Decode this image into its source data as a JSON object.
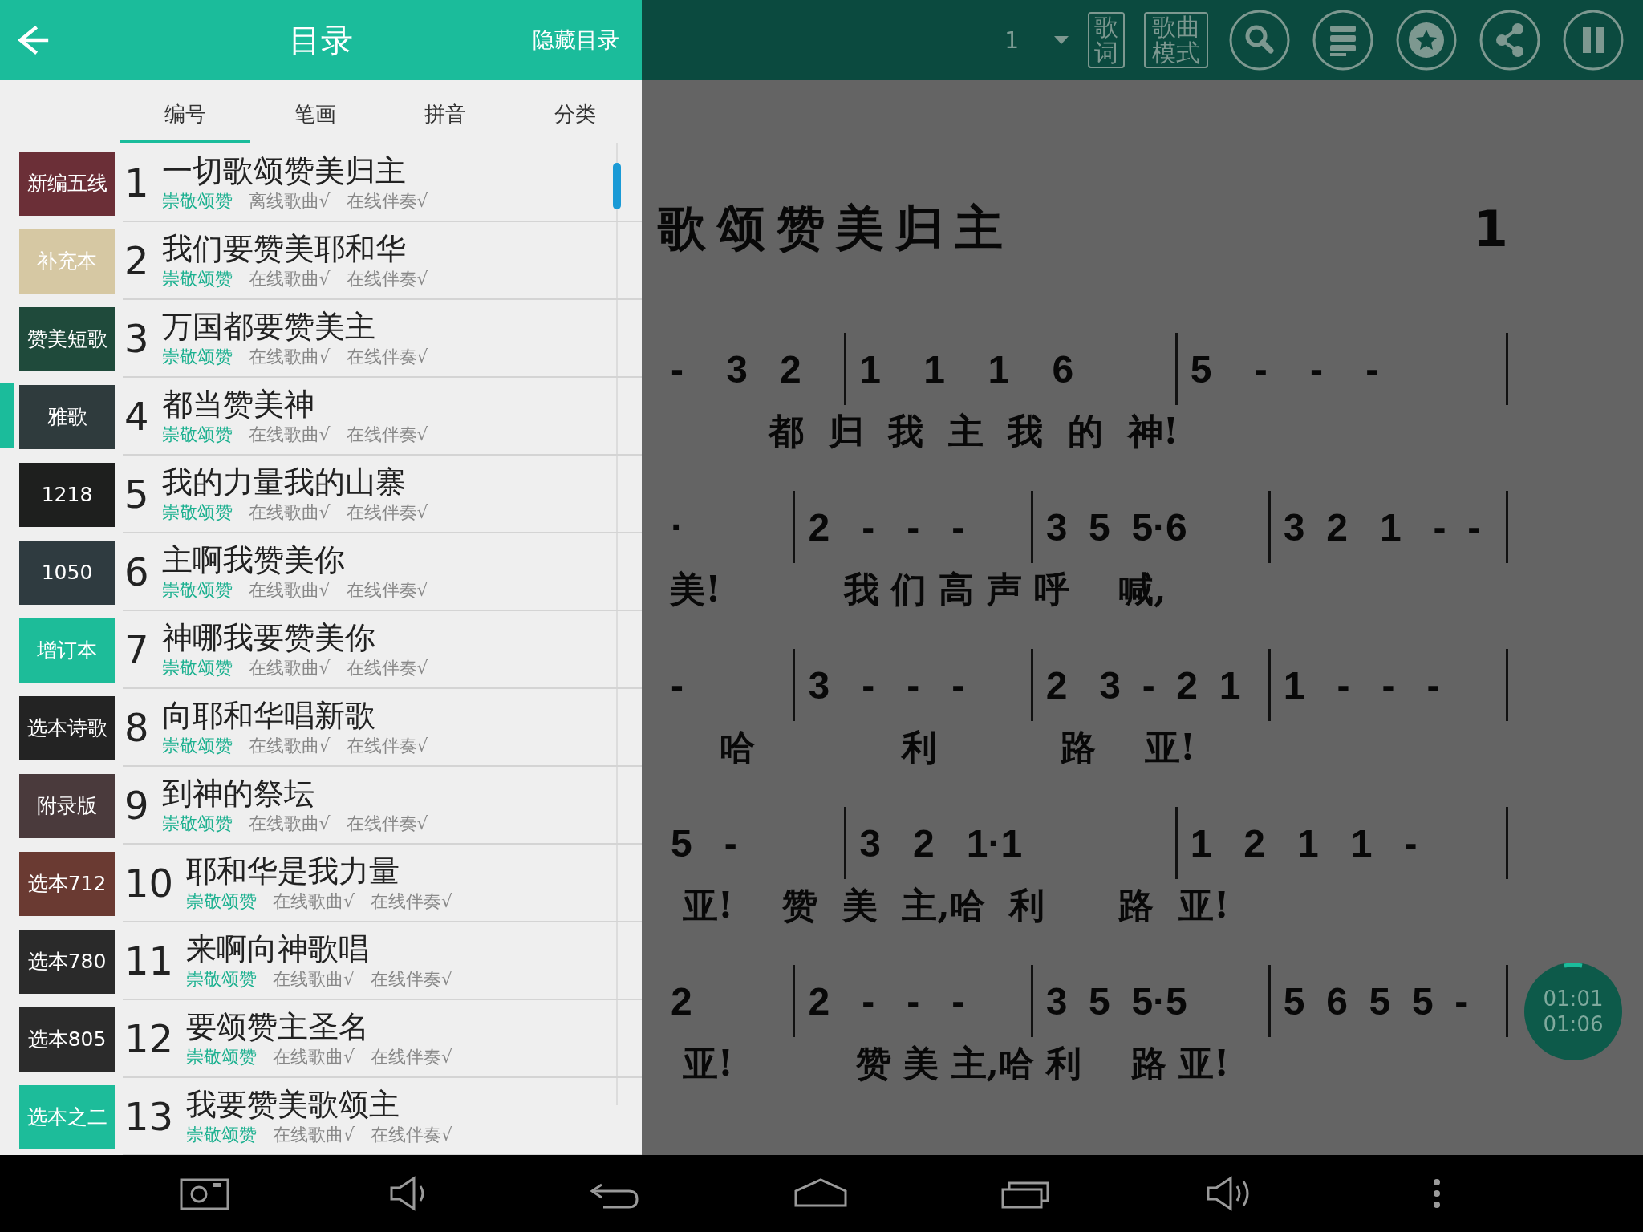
{
  "header": {
    "title": "目录",
    "hide_button": "隐藏目录"
  },
  "toolbar": {
    "page": "1",
    "lyrics_button": "歌词",
    "mode_button": "歌曲模式"
  },
  "sort_tabs": [
    {
      "label": "编号",
      "selected": true
    },
    {
      "label": "笔画",
      "selected": false
    },
    {
      "label": "拼音",
      "selected": false
    },
    {
      "label": "分类",
      "selected": false
    }
  ],
  "songs": [
    {
      "badge": "新编五线",
      "color": "#6b2f37",
      "number": "1",
      "title": "一切歌颂赞美归主",
      "category": "崇敬颂赞",
      "song_status": "离线歌曲√",
      "accompaniment": "在线伴奏√",
      "selected": false
    },
    {
      "badge": "补充本",
      "color": "#d6c8a3",
      "number": "2",
      "title": "我们要赞美耶和华",
      "category": "崇敬颂赞",
      "song_status": "在线歌曲√",
      "accompaniment": "在线伴奏√",
      "selected": false
    },
    {
      "badge": "赞美短歌",
      "color": "#1f4a3b",
      "number": "3",
      "title": "万国都要赞美主",
      "category": "崇敬颂赞",
      "song_status": "在线歌曲√",
      "accompaniment": "在线伴奏√",
      "selected": false
    },
    {
      "badge": "雅歌",
      "color": "#2f3b3d",
      "number": "4",
      "title": "都当赞美神",
      "category": "崇敬颂赞",
      "song_status": "在线歌曲√",
      "accompaniment": "在线伴奏√",
      "selected": true
    },
    {
      "badge": "1218",
      "color": "#1e1f1e",
      "number": "5",
      "title": "我的力量我的山寨",
      "category": "崇敬颂赞",
      "song_status": "在线歌曲√",
      "accompaniment": "在线伴奏√",
      "selected": false
    },
    {
      "badge": "1050",
      "color": "#2f3b40",
      "number": "6",
      "title": "主啊我赞美你",
      "category": "崇敬颂赞",
      "song_status": "在线歌曲√",
      "accompaniment": "在线伴奏√",
      "selected": false
    },
    {
      "badge": "增订本",
      "color": "#1dbc99",
      "number": "7",
      "title": "神哪我要赞美你",
      "category": "崇敬颂赞",
      "song_status": "在线歌曲√",
      "accompaniment": "在线伴奏√",
      "selected": false
    },
    {
      "badge": "选本诗歌",
      "color": "#232323",
      "number": "8",
      "title": "向耶和华唱新歌",
      "category": "崇敬颂赞",
      "song_status": "在线歌曲√",
      "accompaniment": "在线伴奏√",
      "selected": false
    },
    {
      "badge": "附录版",
      "color": "#4a3a3c",
      "number": "9",
      "title": "到神的祭坛",
      "category": "崇敬颂赞",
      "song_status": "在线歌曲√",
      "accompaniment": "在线伴奏√",
      "selected": false
    },
    {
      "badge": "选本712",
      "color": "#6a3a32",
      "number": "10",
      "title": "耶和华是我力量",
      "category": "崇敬颂赞",
      "song_status": "在线歌曲√",
      "accompaniment": "在线伴奏√",
      "selected": false
    },
    {
      "badge": "选本780",
      "color": "#2a2a2a",
      "number": "11",
      "title": "来啊向神歌唱",
      "category": "崇敬颂赞",
      "song_status": "在线歌曲√",
      "accompaniment": "在线伴奏√",
      "selected": false
    },
    {
      "badge": "选本805",
      "color": "#2b2b2b",
      "number": "12",
      "title": "要颂赞主圣名",
      "category": "崇敬颂赞",
      "song_status": "在线歌曲√",
      "accompaniment": "在线伴奏√",
      "selected": false
    },
    {
      "badge": "选本之二",
      "color": "#1dbc9a",
      "number": "13",
      "title": "我要赞美歌颂主",
      "category": "崇敬颂赞",
      "song_status": "在线歌曲√",
      "accompaniment": "在线伴奏√",
      "selected": false
    }
  ],
  "score": {
    "title": "歌颂赞美归主",
    "number": "1",
    "rows": [
      {
        "measures": [
          "-    3   2",
          "1    1    1    6",
          "5    -    -    -"
        ],
        "lyrics": "         都  归  我  主  我  的  神!"
      },
      {
        "measures": [
          "·",
          "2   -   -   -",
          "3  5  5·6",
          "3  2   1   -  -"
        ],
        "lyrics": " 美!          我 们 高 声 呼    喊,"
      },
      {
        "measures": [
          "-",
          "3   -   -   -",
          "2   3  -  2  1",
          "1   -   -   -"
        ],
        "lyrics": "     哈            利          路    亚!"
      },
      {
        "measures": [
          "5   -",
          "3   2   1·1",
          "1   2   1   1   -"
        ],
        "lyrics": "  亚!    赞  美  主,哈  利      路  亚!"
      },
      {
        "measures": [
          "2",
          "2   -   -   -",
          "3  5  5·5",
          "5  6  5  5  -"
        ],
        "lyrics": "  亚!          赞 美 主,哈 利    路 亚!"
      }
    ]
  },
  "timer": {
    "elapsed": "01:01",
    "total": "01:06"
  }
}
